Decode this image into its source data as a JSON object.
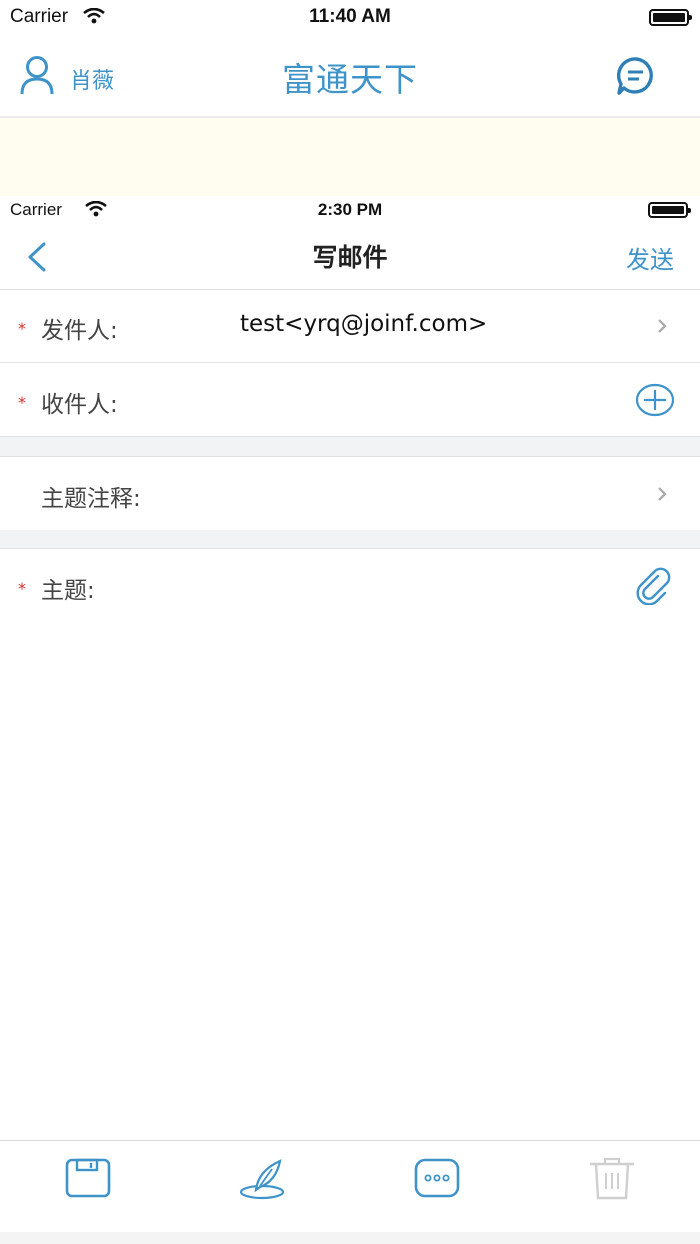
{
  "back_screen": {
    "status": {
      "carrier": "Carrier",
      "time": "11:40 AM"
    },
    "user_name": "肖薇",
    "title": "富通天下"
  },
  "status": {
    "carrier": "Carrier",
    "time": "2:30 PM"
  },
  "nav": {
    "title": "写邮件",
    "send_label": "发送"
  },
  "form": {
    "sender": {
      "required": "*",
      "label": "发件人:",
      "value": "test<yrq@joinf.com>"
    },
    "recipient": {
      "required": "*",
      "label": "收件人:"
    },
    "subject_note": {
      "label": "主题注释:"
    },
    "subject": {
      "required": "*",
      "label": "主题:"
    }
  },
  "toolbar": {
    "items": [
      "save-icon",
      "signature-icon",
      "more-icon",
      "trash-icon"
    ]
  },
  "colors": {
    "accent": "#3e93c9",
    "required": "#d9302b",
    "separator": "#e1e1e1",
    "section_gap": "#f2f3f5"
  }
}
